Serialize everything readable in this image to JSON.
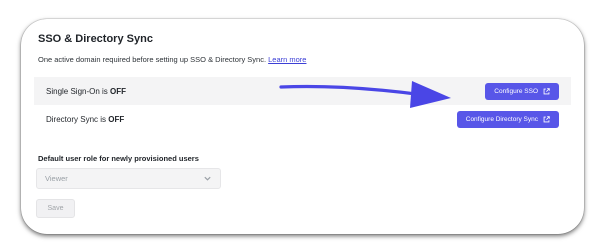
{
  "section": {
    "title": "SSO & Directory Sync",
    "subtitle": "One active domain required before setting up SSO & Directory Sync.",
    "learn_more": "Learn more"
  },
  "rows": [
    {
      "label_prefix": "Single Sign-On is ",
      "status": "OFF",
      "button_label": "Configure SSO",
      "button_icon": "external-link-icon"
    },
    {
      "label_prefix": "Directory Sync is ",
      "status": "OFF",
      "button_label": "Configure Directory Sync",
      "button_icon": "external-link-icon"
    }
  ],
  "default_role": {
    "label": "Default user role for newly provisioned users",
    "selected": "Viewer",
    "icon": "chevron-down-icon"
  },
  "save_label": "Save",
  "colors": {
    "accent": "#5856e8",
    "annotation_arrow": "#4a46e6",
    "link": "#3c3fd6"
  }
}
